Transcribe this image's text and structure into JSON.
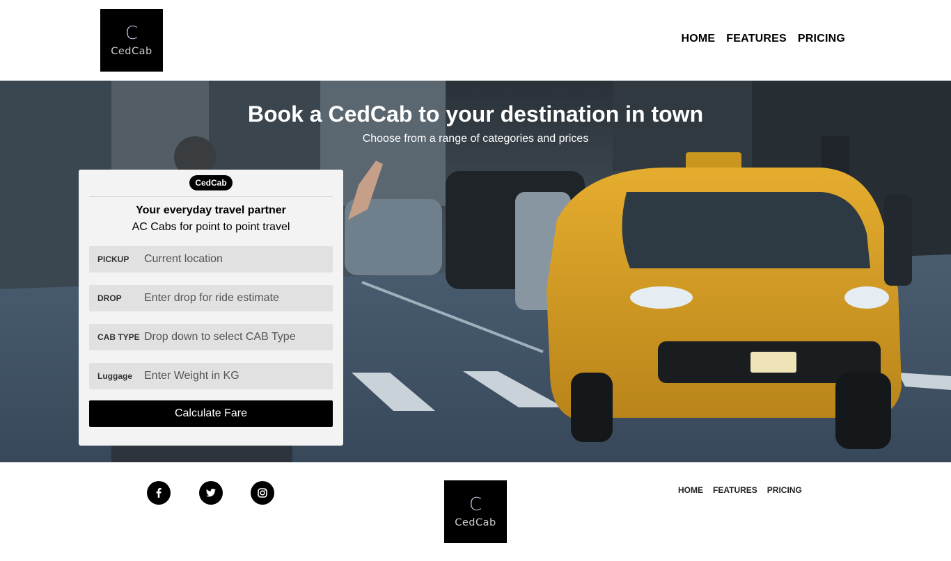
{
  "brand": {
    "logo_mark": "C",
    "logo_word": "CedCab"
  },
  "nav": {
    "home": "HOME",
    "features": "FEATURES",
    "pricing": "PRICING"
  },
  "hero": {
    "title": "Book a CedCab to your destination in town",
    "subtitle": "Choose from a range of categories and prices"
  },
  "card": {
    "badge": "CedCab",
    "heading": "Your everyday travel partner",
    "tagline": "AC Cabs for point to point travel",
    "fields": [
      {
        "label": "PICKUP",
        "value": "Current location"
      },
      {
        "label": "DROP",
        "value": "Enter drop for ride estimate"
      },
      {
        "label": "CAB TYPE",
        "value": "Drop down to select CAB Type"
      },
      {
        "label": "Luggage",
        "value": "Enter Weight in KG"
      }
    ],
    "button": "Calculate Fare"
  },
  "footer": {
    "socials": [
      "facebook-icon",
      "twitter-icon",
      "instagram-icon"
    ],
    "nav": {
      "home": "HOME",
      "features": "FEATURES",
      "pricing": "PRICING"
    }
  },
  "colors": {
    "accent": "#000000",
    "taxi_yellow": "#d9a227",
    "logo_mark": "#d9c8ee"
  }
}
